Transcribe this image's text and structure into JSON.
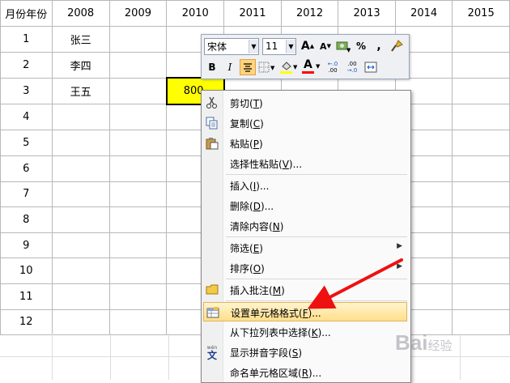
{
  "sheet": {
    "header": [
      "月份年份",
      "2008",
      "2009",
      "2010",
      "2011",
      "2012",
      "2013",
      "2014",
      "2015"
    ],
    "rows": [
      {
        "num": "1",
        "name": "张三"
      },
      {
        "num": "2",
        "name": "李四"
      },
      {
        "num": "3",
        "name": "王五",
        "value": "800"
      },
      {
        "num": "4"
      },
      {
        "num": "5"
      },
      {
        "num": "6"
      },
      {
        "num": "7"
      },
      {
        "num": "8"
      },
      {
        "num": "9"
      },
      {
        "num": "10"
      },
      {
        "num": "11"
      },
      {
        "num": "12"
      }
    ]
  },
  "mini_toolbar": {
    "font_name": "宋体",
    "font_size": "11",
    "bold": "B",
    "italic": "I",
    "percent": "%",
    "comma": ",",
    "decimal_inc": "+.0 .00",
    "decimal_dec": ".00 +.0",
    "font_color_letter": "A",
    "font_color": "#ff0000",
    "fill_color": "#ffff00"
  },
  "context_menu": {
    "items": [
      {
        "icon": "scissors-icon",
        "label": "剪切",
        "key": "T"
      },
      {
        "icon": "copy-icon",
        "label": "复制",
        "key": "C"
      },
      {
        "icon": "paste-icon",
        "label": "粘贴",
        "key": "P"
      },
      {
        "label": "选择性粘贴",
        "key": "V",
        "tail": "..."
      },
      {
        "label": "插入",
        "key": "I",
        "tail": "..."
      },
      {
        "label": "删除",
        "key": "D",
        "tail": "..."
      },
      {
        "label": "清除内容",
        "key": "N"
      },
      {
        "label": "筛选",
        "key": "E",
        "submenu": true
      },
      {
        "label": "排序",
        "key": "O",
        "submenu": true
      },
      {
        "icon": "comment-icon",
        "label": "插入批注",
        "key": "M"
      },
      {
        "icon": "format-cells-icon",
        "label": "设置单元格格式",
        "key": "F",
        "tail": "...",
        "highlighted": true
      },
      {
        "label": "从下拉列表中选择",
        "key": "K",
        "tail": "..."
      },
      {
        "icon": "phonetic-icon",
        "icon_text": "文",
        "label": "显示拼音字段",
        "key": "S"
      },
      {
        "label": "命名单元格区域",
        "key": "R",
        "tail": "..."
      }
    ]
  },
  "watermark": {
    "brand": "Bai",
    "suffix": "经验"
  },
  "colors": {
    "selected_cell": "#ffff00",
    "arrow": "#ee1111",
    "menu_highlight": "#ffdf8a"
  }
}
